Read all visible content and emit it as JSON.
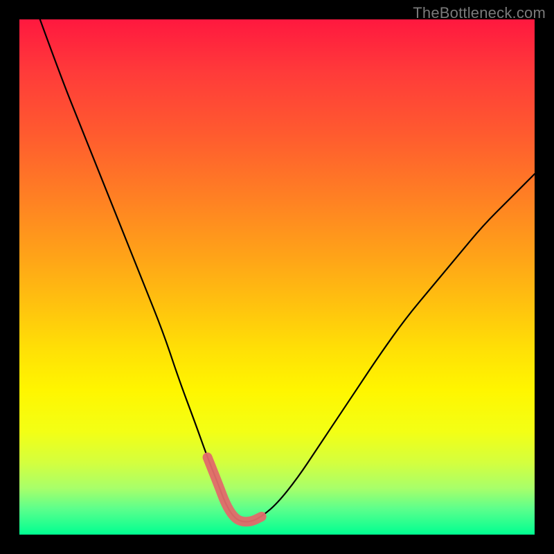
{
  "watermark": "TheBottleneck.com",
  "chart_data": {
    "type": "line",
    "title": "",
    "xlabel": "",
    "ylabel": "",
    "xlim": [
      0,
      100
    ],
    "ylim": [
      0,
      100
    ],
    "series": [
      {
        "name": "bottleneck-curve",
        "x": [
          4,
          8,
          12,
          16,
          20,
          24,
          28,
          31,
          34,
          36.5,
          38.5,
          40,
          41.5,
          43,
          45,
          47,
          50,
          54,
          58,
          62,
          66,
          70,
          75,
          80,
          85,
          90,
          95,
          100
        ],
        "y": [
          100,
          89,
          79,
          69,
          59,
          49,
          39,
          30,
          22,
          15,
          10,
          6,
          3.5,
          2.5,
          2.5,
          3.5,
          6,
          11,
          17,
          23,
          29,
          35,
          42,
          48,
          54,
          60,
          65,
          70
        ]
      },
      {
        "name": "highlight-segment",
        "x": [
          36.5,
          38.5,
          40,
          41.5,
          43,
          45,
          47
        ],
        "y": [
          15,
          10,
          6,
          3.5,
          2.5,
          2.5,
          3.5,
          6
        ]
      }
    ],
    "colors": {
      "curve": "#000000",
      "highlight": "#e26a6a",
      "gradient_top": "#ff183f",
      "gradient_bottom": "#00ff91"
    }
  }
}
